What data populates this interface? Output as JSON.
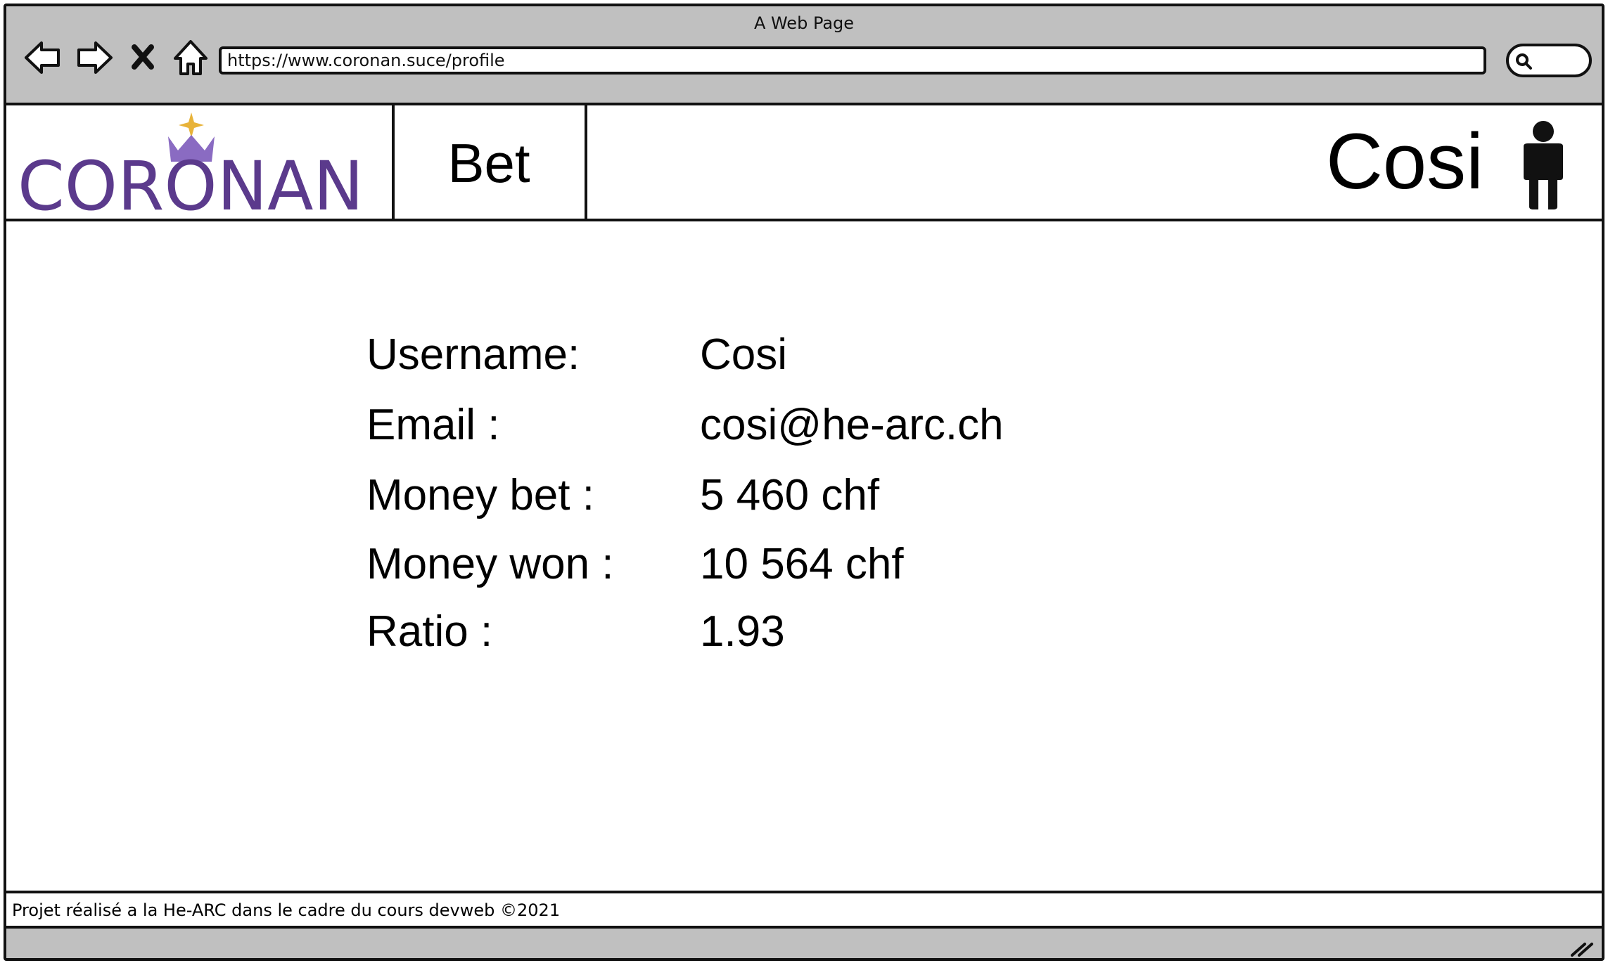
{
  "browser": {
    "window_title": "A Web Page",
    "url": "https://www.coronan.suce/profile",
    "icons": {
      "back": "back-arrow-icon",
      "forward": "forward-arrow-icon",
      "stop": "close-icon",
      "home": "home-icon",
      "search": "search-icon"
    }
  },
  "site": {
    "logo_text": "CORONAN",
    "brand_color": "#5b3a8c",
    "crown_color": "#8a6bc2",
    "star_color": "#e8b33a",
    "nav": {
      "bet_label": "Bet"
    },
    "header_username": "Cosi",
    "user_icon": "person-icon"
  },
  "profile": {
    "rows": [
      {
        "label": "Username:",
        "value": "Cosi"
      },
      {
        "label": "Email :",
        "value": "cosi@he-arc.ch"
      },
      {
        "label": "Money bet :",
        "value": "5 460 chf"
      },
      {
        "label": "Money won :",
        "value": "10 564 chf"
      },
      {
        "label": "Ratio :",
        "value": "1.93"
      }
    ]
  },
  "footer": {
    "text": "Projet réalisé a la He-ARC dans le cadre du cours devweb ©2021"
  },
  "status_bar": {
    "grip_icon": "resize-grip-icon"
  }
}
